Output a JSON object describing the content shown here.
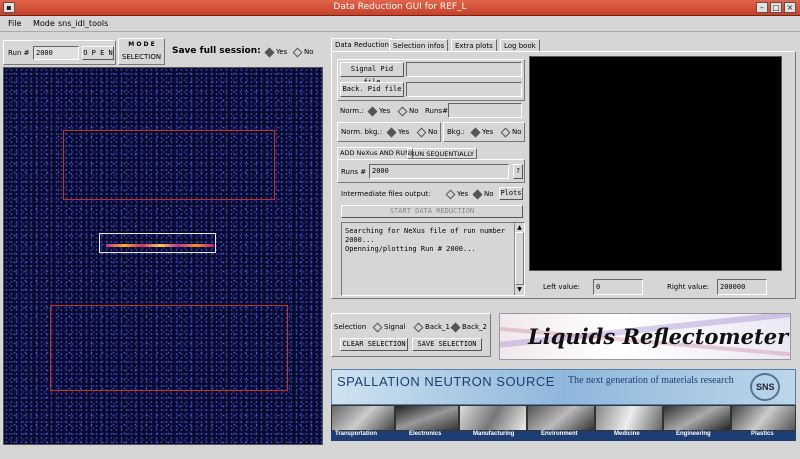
{
  "window": {
    "title": "Data Reduction GUI for REF_L",
    "buttons": [
      "–",
      "□",
      "×"
    ]
  },
  "menu": {
    "items": [
      "File",
      "Mode",
      "sns_idl_tools"
    ]
  },
  "run_panel": {
    "label": "Run #",
    "value": "2000",
    "open_label": "O P E N"
  },
  "mode_panel": {
    "title": "M O D E",
    "value": "SELECTION"
  },
  "session": {
    "label": "Save full session:",
    "yes": "Yes",
    "no": "No",
    "selected": "Yes"
  },
  "tabs": [
    {
      "label": "Data Reduction",
      "active": true
    },
    {
      "label": "Selection infos",
      "active": false
    },
    {
      "label": "Extra plots",
      "active": false
    },
    {
      "label": "Log book",
      "active": false
    }
  ],
  "reduction": {
    "signal_pid_label": "Signal Pid file",
    "back_pid_label": "Back. Pid file",
    "norm_label": "Norm.:",
    "norm_yes": "Yes",
    "norm_no": "No",
    "runs_label": "Runs#",
    "norm_bkg_label": "Norm. bkg.:",
    "norm_bkg_yes": "Yes",
    "norm_bkg_no": "No",
    "bkg_label": "Bkg.:",
    "bkg_yes": "Yes",
    "bkg_no": "No",
    "subtabs": [
      "ADD NeXus AND RUN",
      "RUN SEQUENTIALLY"
    ],
    "runs_field_label": "Runs #",
    "runs_value": "2000",
    "help_label": "?",
    "intermediate_label": "Intermediate files output:",
    "intermediate_yes": "Yes",
    "intermediate_no": "No",
    "plots_label": "Plots",
    "start_label": "START DATA REDUCTION",
    "log_lines": [
      "Searching for NeXus file of run number",
      "2000...",
      "Openning/plotting Run # 2000..."
    ]
  },
  "selection": {
    "label": "Selection",
    "options": [
      "Signal",
      "Back_1",
      "Back_2"
    ],
    "selected": "Back_2",
    "clear_label": "CLEAR SELECTION",
    "save_label": "SAVE SELECTION"
  },
  "values": {
    "left_label": "Left value:",
    "left_value": "0",
    "right_label": "Right value:",
    "right_value": "200000"
  },
  "banner": {
    "logo_text": "Liquids Reflectometer",
    "sns_title": "SPALLATION NEUTRON SOURCE",
    "sns_tagline": "The next generation of materials research",
    "sns_mark": "SNS",
    "categories": [
      "Transportation",
      "Electronics",
      "Manufacturing",
      "Environment",
      "Medicine",
      "Engineering",
      "Plastics"
    ]
  },
  "colors": {
    "title_bar": "#d04a33",
    "plot_bg": "#0a0a2a",
    "roi": "#c0302a"
  }
}
